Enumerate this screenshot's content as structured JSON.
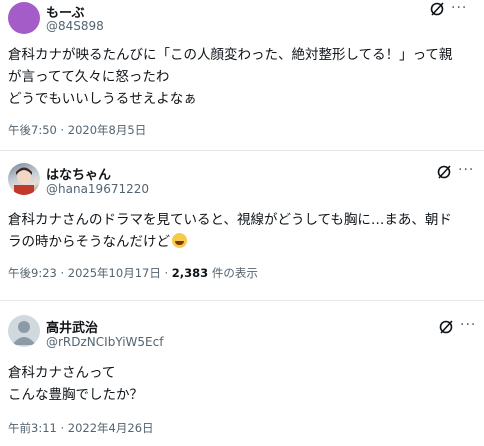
{
  "posts": [
    {
      "name": "もーぶ",
      "handle": "@84S898",
      "text": "倉科カナが映るたんびに「この人顔変わった、絶対整形してる！」って親\nが言ってて久々に怒ったわ\nどうでもいいしうるせえよなぁ",
      "time": "午後7:50 · 2020年8月5日",
      "avatar_color": "#a45cc9",
      "icons": [
        "grok-icon",
        "more-icon"
      ]
    },
    {
      "name": "はなちゃん",
      "handle": "@hana19671220",
      "text": "倉科カナさんのドラマを見ていると、視線がどうしても胸に…まあ、朝ド\nラの時からそうなんだけど",
      "emoji": "grinning-squinting-face-emoji",
      "time": "午後9:23 · 2025年10月17日 · ",
      "views": "2,383",
      "views_label": " 件の表示",
      "icons": [
        "grok-icon",
        "more-icon"
      ]
    },
    {
      "name": "高井武治",
      "handle": "@rRDzNCIbYiW5Ecf",
      "text": "倉科カナさんって\nこんな豊胸でしたか？",
      "time": "午前3:11 · 2022年4月26日",
      "avatar_color": "#cfd9de",
      "icons": [
        "grok-icon",
        "more-icon"
      ]
    }
  ],
  "more_glyph": "···"
}
